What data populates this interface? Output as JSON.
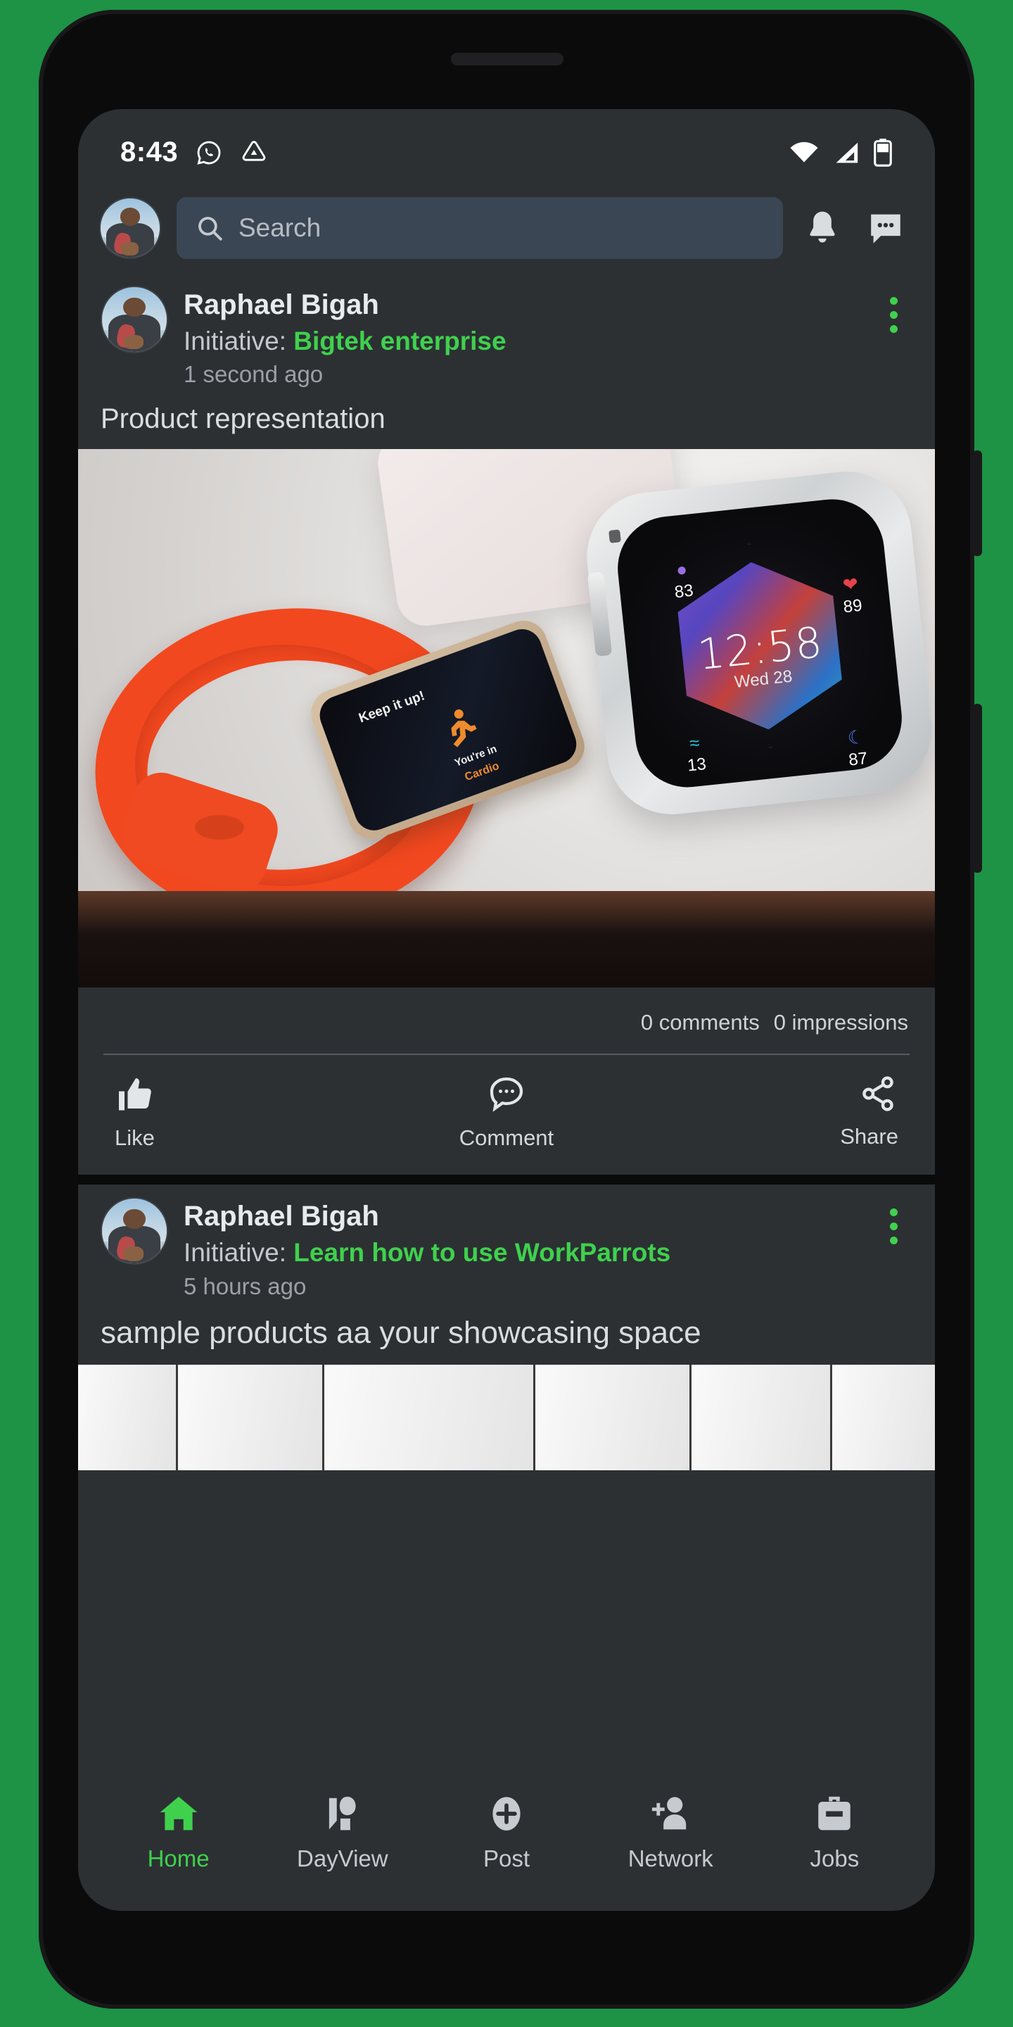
{
  "status_bar": {
    "time": "8:43",
    "left_icons": [
      "whatsapp-icon",
      "triangle-app-icon"
    ],
    "right_icons": [
      "wifi-icon",
      "cellular-signal-icon",
      "battery-icon"
    ]
  },
  "app_bar": {
    "avatar": "user-avatar",
    "search": {
      "placeholder": "Search",
      "icon": "search-icon"
    },
    "notifications_icon": "bell-icon",
    "messages_icon": "message-icon"
  },
  "feed": {
    "posts": [
      {
        "author": "Raphael Bigah",
        "initiative_label": "Initiative:",
        "initiative_name": "Bigtek enterprise",
        "time": "1 second ago",
        "text": "Product representation",
        "menu_icon": "kebab-menu-icon",
        "stats": {
          "comments": "0 comments",
          "impressions": "0 impressions"
        },
        "actions": [
          {
            "label": "Like",
            "icon": "thumbs-up-icon"
          },
          {
            "label": "Comment",
            "icon": "comment-bubble-icon"
          },
          {
            "label": "Share",
            "icon": "share-nodes-icon"
          }
        ],
        "image": {
          "alt": "fitness band and smartwatch product photo",
          "band": {
            "headline": "Keep it up!",
            "sub_line1": "You're in",
            "sub_line2": "Cardio",
            "icon": "running-person-icon"
          },
          "watch": {
            "time": "12:58",
            "date": "Wed 28",
            "metrics": [
              {
                "icon": "stand-icon",
                "value": "83"
              },
              {
                "icon": "heart-icon",
                "value": "89"
              },
              {
                "icon": "active-zone-icon",
                "value": "13"
              },
              {
                "icon": "sleep-moon-icon",
                "value": "87"
              }
            ]
          }
        }
      },
      {
        "author": "Raphael Bigah",
        "initiative_label": "Initiative:",
        "initiative_name": "Learn how to use  WorkParrots",
        "time": "5 hours ago",
        "text": "sample products aa your showcasing space",
        "menu_icon": "kebab-menu-icon"
      }
    ]
  },
  "bottom_nav": {
    "items": [
      {
        "label": "Home",
        "icon": "home-icon",
        "active": true
      },
      {
        "label": "DayView",
        "icon": "dayview-icon",
        "active": false
      },
      {
        "label": "Post",
        "icon": "plus-circle-icon",
        "active": false
      },
      {
        "label": "Network",
        "icon": "person-add-icon",
        "active": false
      },
      {
        "label": "Jobs",
        "icon": "briefcase-icon",
        "active": false
      }
    ]
  },
  "colors": {
    "page_background": "#1E9245",
    "screen_background": "#2c3033",
    "accent_green": "#3fd14d",
    "search_field": "#3b4654"
  }
}
